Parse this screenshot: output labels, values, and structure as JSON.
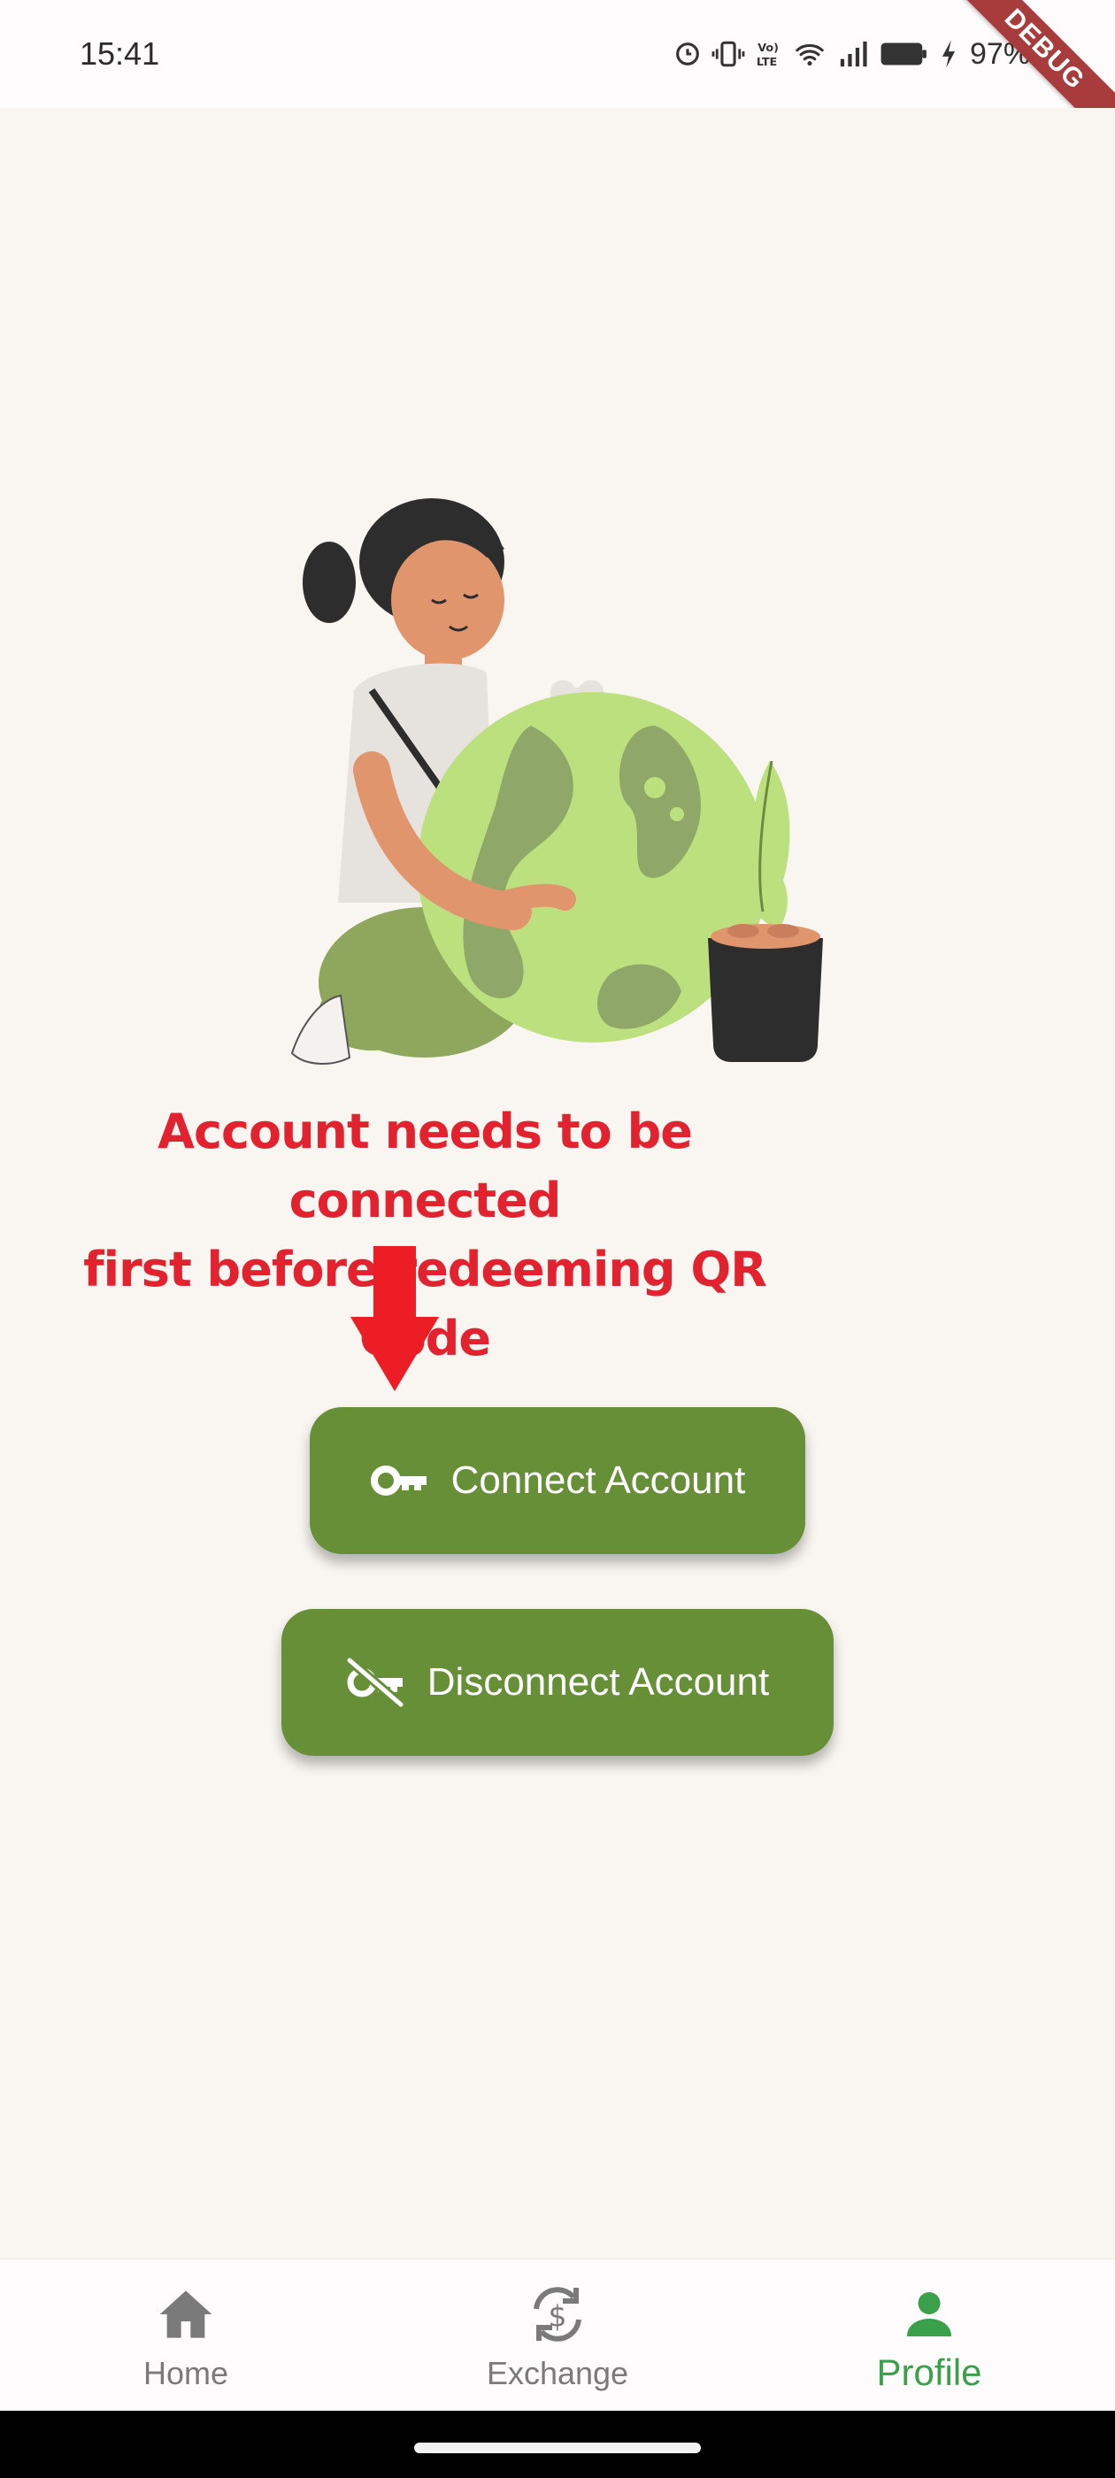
{
  "status_bar": {
    "time": "15:41",
    "battery": "97%",
    "icons": [
      "alarm-icon",
      "vibrate-icon",
      "volte-icon",
      "wifi-icon",
      "signal-icon",
      "battery-icon",
      "charging-icon"
    ]
  },
  "debug_banner": "DEBUG",
  "annotation": {
    "line1": "Account needs to be connected",
    "line2": "first before redeeming QR Code",
    "color": "#e2232f"
  },
  "buttons": {
    "connect": {
      "label": "Connect Account",
      "icon": "key-icon"
    },
    "disconnect": {
      "label": "Disconnect Account",
      "icon": "key-off-icon"
    }
  },
  "nav": {
    "home": {
      "label": "Home",
      "icon": "home-icon"
    },
    "exchange": {
      "label": "Exchange",
      "icon": "currency-exchange-icon"
    },
    "profile": {
      "label": "Profile",
      "icon": "person-icon",
      "active": true
    }
  },
  "colors": {
    "accent_green": "#678f38",
    "active_nav": "#3aa14a",
    "inactive_nav": "#7a7a7a",
    "background": "#f9f6f1"
  }
}
